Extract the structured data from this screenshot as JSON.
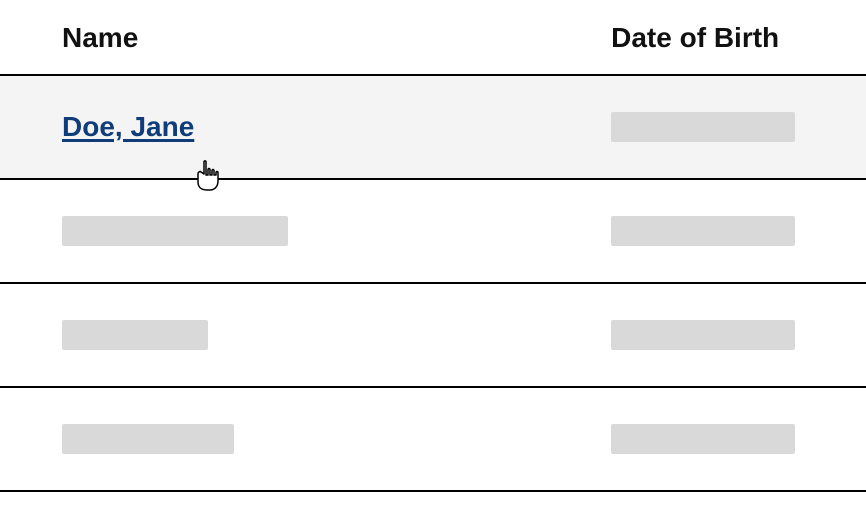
{
  "table": {
    "headers": {
      "name": "Name",
      "dob": "Date of Birth"
    },
    "row1": {
      "name": "Doe, Jane"
    }
  }
}
